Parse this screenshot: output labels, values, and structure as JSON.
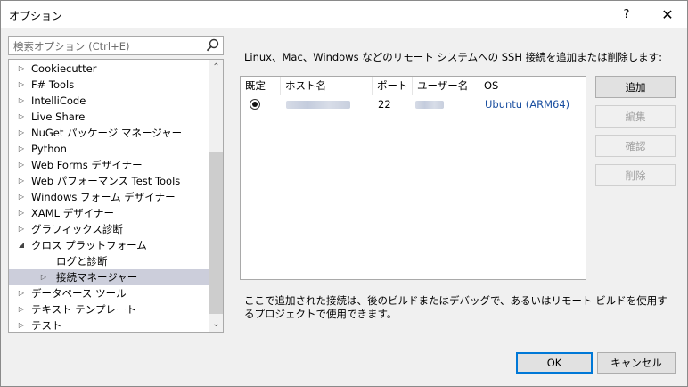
{
  "window": {
    "title": "オプション",
    "help": "?",
    "close": "✕"
  },
  "search": {
    "placeholder": "検索オプション (Ctrl+E)"
  },
  "tree": {
    "items": [
      {
        "label": "Cookiecutter",
        "arrow": "▷",
        "level": 0
      },
      {
        "label": "F# Tools",
        "arrow": "▷",
        "level": 0
      },
      {
        "label": "IntelliCode",
        "arrow": "▷",
        "level": 0
      },
      {
        "label": "Live Share",
        "arrow": "▷",
        "level": 0
      },
      {
        "label": "NuGet パッケージ マネージャー",
        "arrow": "▷",
        "level": 0
      },
      {
        "label": "Python",
        "arrow": "▷",
        "level": 0
      },
      {
        "label": "Web Forms デザイナー",
        "arrow": "▷",
        "level": 0
      },
      {
        "label": "Web パフォーマンス Test Tools",
        "arrow": "▷",
        "level": 0
      },
      {
        "label": "Windows フォーム デザイナー",
        "arrow": "▷",
        "level": 0
      },
      {
        "label": "XAML デザイナー",
        "arrow": "▷",
        "level": 0
      },
      {
        "label": "グラフィックス診断",
        "arrow": "▷",
        "level": 0
      },
      {
        "label": "クロス プラットフォーム",
        "arrow": "◢",
        "level": 0
      },
      {
        "label": "ログと診断",
        "arrow": "",
        "level": 1
      },
      {
        "label": "接続マネージャー",
        "arrow": "▷",
        "level": 1,
        "selected": true
      },
      {
        "label": "データベース ツール",
        "arrow": "▷",
        "level": 0
      },
      {
        "label": "テキスト テンプレート",
        "arrow": "▷",
        "level": 0
      },
      {
        "label": "テスト",
        "arrow": "▷",
        "level": 0
      }
    ],
    "scroll_up": "⌃",
    "scroll_down": "⌄"
  },
  "main": {
    "description": "Linux、Mac、Windows などのリモート システムへの SSH 接続を追加または削除します:",
    "columns": {
      "default": "既定",
      "host": "ホスト名",
      "port": "ポート",
      "user": "ユーザー名",
      "os": "OS"
    },
    "rows": [
      {
        "port": "22",
        "os": "Ubuntu (ARM64)"
      }
    ],
    "note": "ここで追加された接続は、後のビルドまたはデバッグで、あるいはリモート ビルドを使用するプロジェクトで使用できます。"
  },
  "buttons": {
    "add": "追加",
    "edit": "編集",
    "confirm": "確認",
    "delete": "削除",
    "ok": "OK",
    "cancel": "キャンセル"
  },
  "colors": {
    "accent": "#0078d7",
    "selection": "#cccedb",
    "link": "#1a4fa0"
  }
}
